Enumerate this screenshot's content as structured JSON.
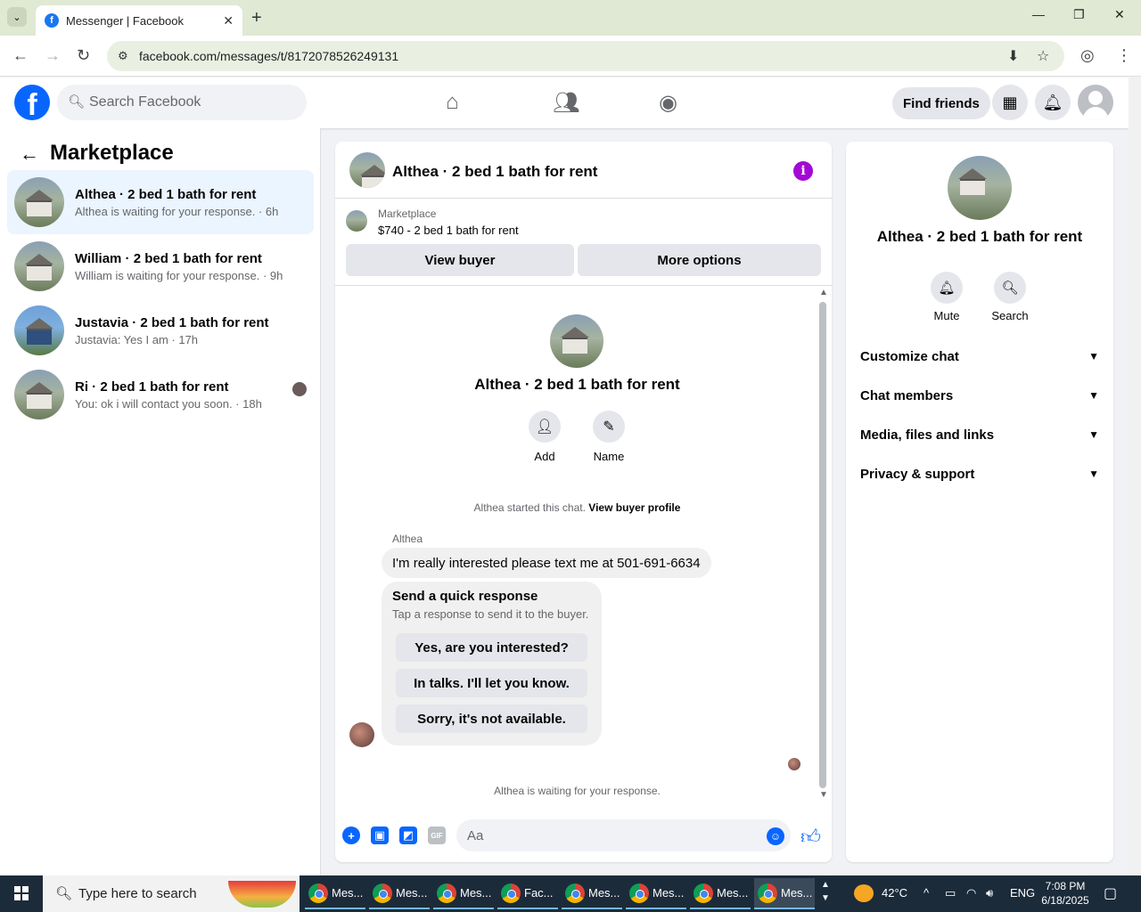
{
  "browser": {
    "tab_title": "Messenger | Facebook",
    "url": "facebook.com/messages/t/8172078526249131"
  },
  "header": {
    "search_placeholder": "Search Facebook",
    "find_friends": "Find friends"
  },
  "left": {
    "title": "Marketplace",
    "conversations": [
      {
        "title": "Althea · 2 bed 1 bath for rent",
        "sub": "Althea is waiting for your response. · 6h"
      },
      {
        "title": "William · 2 bed 1 bath for rent",
        "sub": "William is waiting for your response. · 9h"
      },
      {
        "title": "Justavia · 2 bed 1 bath for rent",
        "sub": "Justavia: Yes I am · 17h"
      },
      {
        "title": "Ri · 2 bed 1 bath for rent",
        "sub": "You: ok i will contact you soon. · 18h"
      }
    ]
  },
  "chat": {
    "title": "Althea · 2 bed 1 bath for rent",
    "marketplace_label": "Marketplace",
    "listing": "$740 - 2 bed 1 bath for rent",
    "view_buyer": "View buyer",
    "more_options": "More options",
    "profile_name": "Althea · 2 bed 1 bath for rent",
    "add_label": "Add",
    "name_label": "Name",
    "started_text": "Althea started this chat.",
    "view_buyer_profile": "View buyer profile",
    "sender": "Althea",
    "message": "I'm really interested please text me at 501-691-6634",
    "quick_title": "Send a quick response",
    "quick_sub": "Tap a response to send it to the buyer.",
    "quick_responses": [
      "Yes, are you interested?",
      "In talks. I'll let you know.",
      "Sorry, it's not available."
    ],
    "waiting": "Althea is waiting for your response.",
    "input_placeholder": "Aa"
  },
  "right": {
    "name": "Althea · 2 bed 1 bath for rent",
    "mute": "Mute",
    "search": "Search",
    "sections": [
      "Customize chat",
      "Chat members",
      "Media, files and links",
      "Privacy & support"
    ]
  },
  "taskbar": {
    "search_placeholder": "Type here to search",
    "items": [
      "Mes...",
      "Mes...",
      "Mes...",
      "Fac...",
      "Mes...",
      "Mes...",
      "Mes...",
      "Mes..."
    ],
    "temperature": "42°C",
    "language": "ENG",
    "time": "7:08 PM",
    "date": "6/18/2025"
  }
}
